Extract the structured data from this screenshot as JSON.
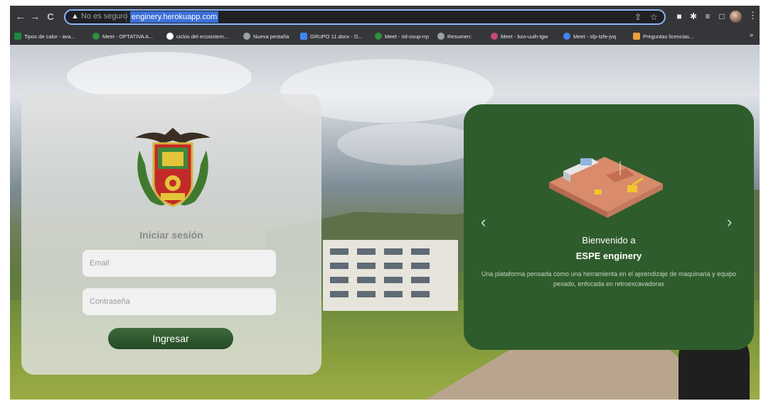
{
  "browser": {
    "nav": {
      "back": "←",
      "forward": "→",
      "reload": "C"
    },
    "address": {
      "security_label": "No es seguro",
      "url": "enginery.herokuapp.com"
    },
    "bookmarks": [
      {
        "label": "Tipos de calor - ava...",
        "color": "#1b8a3e"
      },
      {
        "label": "Meet - OPTATIVA A...",
        "color": "#2d8f3c"
      },
      {
        "label": "ciclos del ecosistem...",
        "color": "#4285f4"
      },
      {
        "label": "Nueva pestaña",
        "color": "#9aa0a6"
      },
      {
        "label": "GRUPO 11.docx - D...",
        "color": "#4285f4"
      },
      {
        "label": "Meet - rid-osup-rrp",
        "color": "#2d8f3c"
      },
      {
        "label": "Resumen:",
        "color": "#9aa0a6"
      },
      {
        "label": "Meet - bzo-uuih-tgw",
        "color": "#c4477a"
      },
      {
        "label": "Meet - sfp-tzfe-jvq",
        "color": "#4285f4"
      },
      {
        "label": "Preguntas licencias...",
        "color": "#e8a13b"
      }
    ],
    "more_bookmarks": "»"
  },
  "login": {
    "title": "Iniciar sesión",
    "email_placeholder": "Email",
    "password_placeholder": "Contraseña",
    "submit_label": "Ingresar"
  },
  "carousel": {
    "heading": "Bienvenido a",
    "title": "ESPE enginery",
    "description": "Una plataforma pensada como una herramienta en el aprendizaje de maquinaria y equipo pesado, enfocada en retroexcavadoras",
    "prev": "‹",
    "next": "›"
  },
  "colors": {
    "carousel_bg": "#2f5c2c",
    "button_green": "#2f5c2c",
    "url_highlight": "#3b6fd8"
  }
}
